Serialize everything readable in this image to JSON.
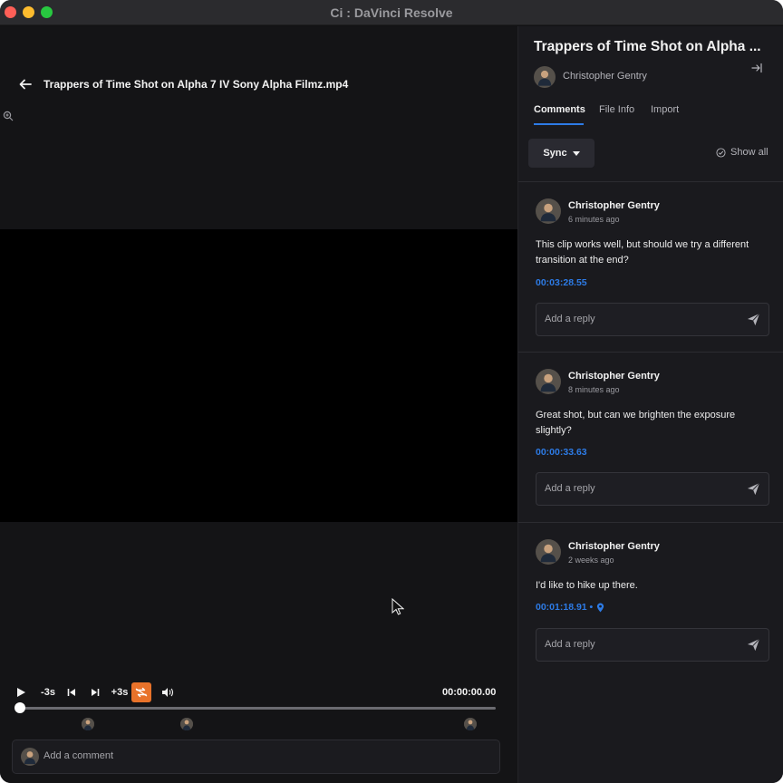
{
  "window": {
    "title": "Ci : DaVinci Resolve"
  },
  "viewer": {
    "file_title": "Trappers of Time Shot on Alpha 7 IV Sony Alpha Filmz.mp4",
    "controls": {
      "minus_label": "-3s",
      "plus_label": "+3s",
      "timecode": "00:00:00.00"
    },
    "add_comment_placeholder": "Add a comment"
  },
  "panel": {
    "title": "Trappers of Time Shot on Alpha ...",
    "owner": "Christopher Gentry",
    "tabs": [
      {
        "label": "Comments",
        "active": true
      },
      {
        "label": "File Info",
        "active": false
      },
      {
        "label": "Import",
        "active": false
      }
    ],
    "sync_label": "Sync",
    "show_all_label": "Show all",
    "comments": [
      {
        "author": "Christopher Gentry",
        "time": "6 minutes ago",
        "text": "This clip works well, but should we try a different transition at the end?",
        "timestamp": "00:03:28.55",
        "reply_placeholder": "Add a reply"
      },
      {
        "author": "Christopher Gentry",
        "time": "8 minutes ago",
        "text": "Great shot, but can we brighten the exposure slightly?",
        "timestamp": "00:00:33.63",
        "reply_placeholder": "Add a reply"
      },
      {
        "author": "Christopher Gentry",
        "time": "2 weeks ago",
        "text": "I'd like to hike up there.",
        "timestamp": "00:01:18.91 •",
        "reply_placeholder": "Add a reply"
      }
    ]
  },
  "colors": {
    "accent": "#2d7be6",
    "loop_active": "#e8722a"
  }
}
